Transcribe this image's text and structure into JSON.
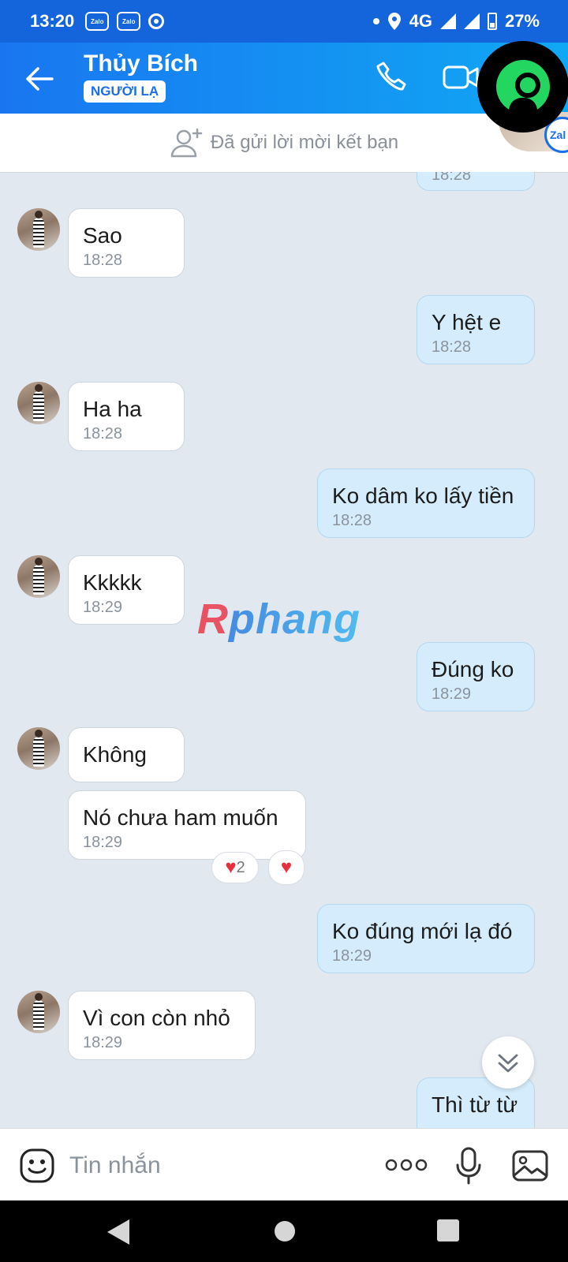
{
  "status_bar": {
    "time": "13:20",
    "network": "4G",
    "battery": "27%",
    "app_icons": [
      "zalo-icon",
      "zalo-icon",
      "location-ring-icon"
    ],
    "zalo_label": "Zalo"
  },
  "header": {
    "contact_name": "Thủy Bích",
    "badge": "NGƯỜI LẠ",
    "peek_label": "Zal"
  },
  "friend_request": {
    "text": "Đã gửi lời mời kết bạn"
  },
  "messages": [
    {
      "side": "out",
      "text": "",
      "time": "18:28"
    },
    {
      "side": "in",
      "text": "Sao",
      "time": "18:28"
    },
    {
      "side": "out",
      "text": "Y hệt e",
      "time": "18:28"
    },
    {
      "side": "in",
      "text": "Ha ha",
      "time": "18:28"
    },
    {
      "side": "out",
      "text": "Ko dâm ko lấy tiền",
      "time": "18:28"
    },
    {
      "side": "in",
      "text": "Kkkkk",
      "time": "18:29"
    },
    {
      "side": "out",
      "text": "Đúng ko",
      "time": "18:29"
    },
    {
      "side": "in",
      "text": "Không",
      "time": ""
    },
    {
      "side": "in",
      "text": "Nó chưa ham muốn",
      "time": "18:29",
      "reaction_count": "2"
    },
    {
      "side": "out",
      "text": "Ko đúng mới lạ đó",
      "time": "18:29"
    },
    {
      "side": "in",
      "text": "Vì con còn nhỏ",
      "time": "18:29"
    },
    {
      "side": "out",
      "text": "Thì từ từ",
      "time": ""
    }
  ],
  "watermark": "Rphang",
  "input": {
    "placeholder": "Tin nhắn"
  },
  "colors": {
    "header_start": "#1976f0",
    "header_end": "#10a8f4",
    "outgoing_bubble": "#d4ecfc",
    "incoming_bubble": "#ffffff",
    "chat_background": "#e2e8ef"
  }
}
